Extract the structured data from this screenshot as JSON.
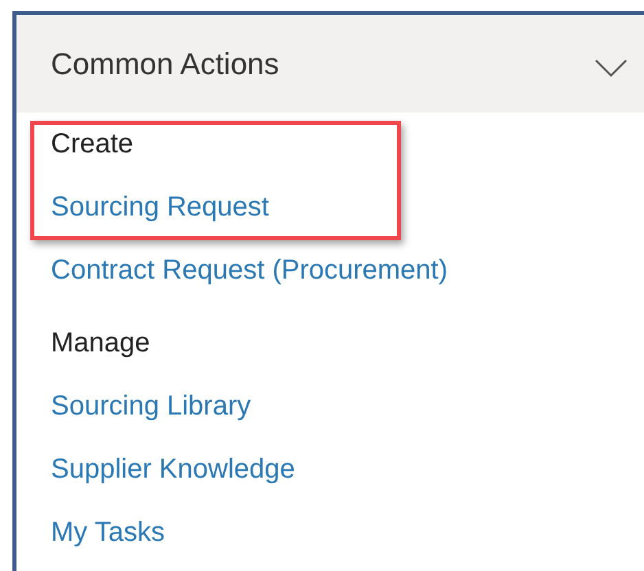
{
  "panel": {
    "title": "Common Actions",
    "rows": [
      {
        "kind": "heading",
        "text": "Create",
        "highlighted": true
      },
      {
        "kind": "link",
        "text": "Sourcing Request",
        "highlighted": true
      },
      {
        "kind": "link",
        "text": "Contract Request (Procurement)",
        "highlighted": false
      },
      {
        "kind": "heading",
        "text": "Manage",
        "highlighted": false
      },
      {
        "kind": "link",
        "text": "Sourcing Library",
        "highlighted": false
      },
      {
        "kind": "link",
        "text": "Supplier Knowledge",
        "highlighted": false
      },
      {
        "kind": "link",
        "text": "My Tasks",
        "highlighted": false
      }
    ]
  }
}
